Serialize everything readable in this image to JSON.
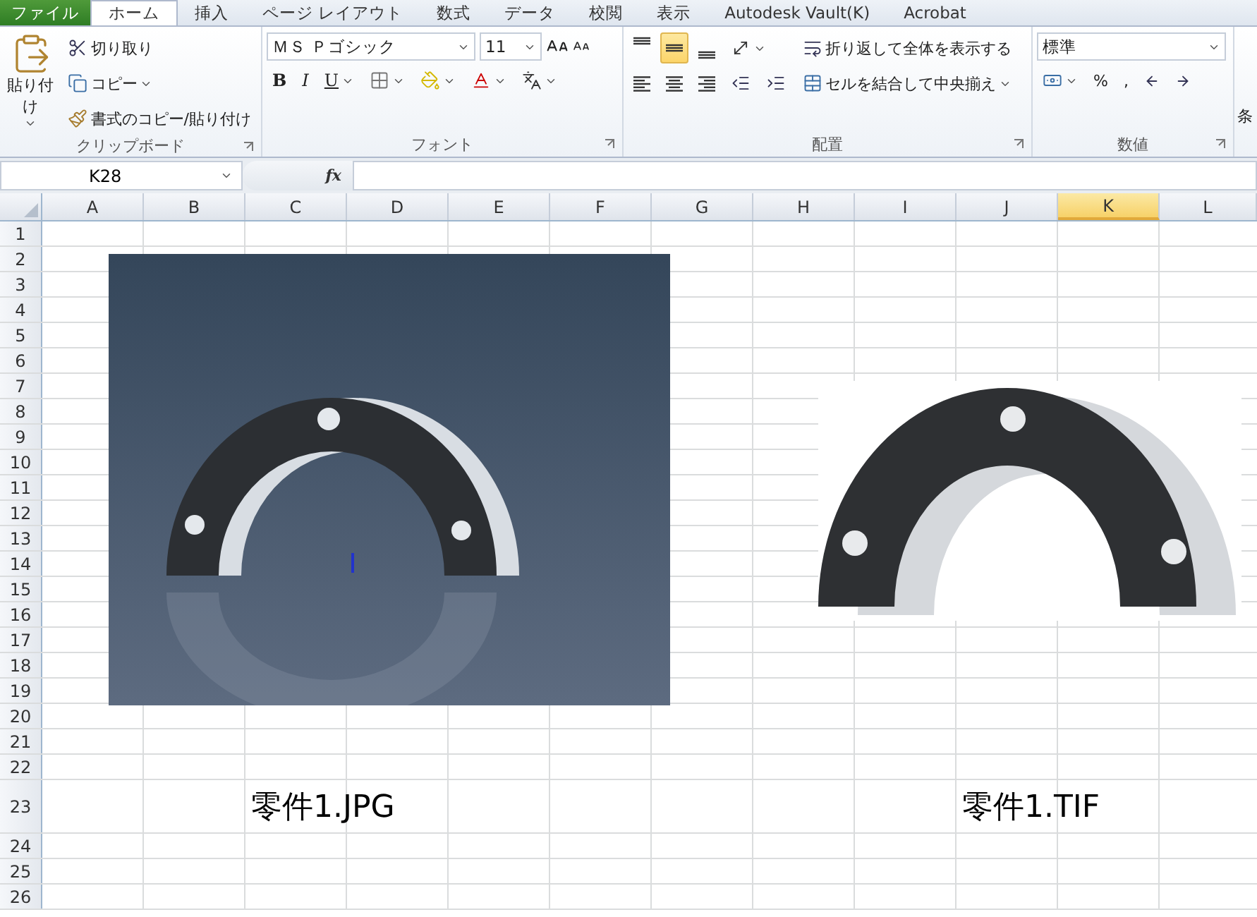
{
  "tabs": [
    {
      "label": "ファイル",
      "kind": "file",
      "selected": false
    },
    {
      "label": "ホーム",
      "kind": "tab",
      "selected": true
    },
    {
      "label": "挿入",
      "kind": "tab",
      "selected": false
    },
    {
      "label": "ページ レイアウト",
      "kind": "tab",
      "selected": false
    },
    {
      "label": "数式",
      "kind": "tab",
      "selected": false
    },
    {
      "label": "データ",
      "kind": "tab",
      "selected": false
    },
    {
      "label": "校閲",
      "kind": "tab",
      "selected": false
    },
    {
      "label": "表示",
      "kind": "tab",
      "selected": false
    },
    {
      "label": "Autodesk Vault(K)",
      "kind": "tab",
      "selected": false
    },
    {
      "label": "Acrobat",
      "kind": "tab",
      "selected": false
    }
  ],
  "clipboard": {
    "paste": "貼り付け",
    "cut": "切り取り",
    "copy": "コピー",
    "format_painter": "書式のコピー/貼り付け",
    "label": "クリップボード"
  },
  "font": {
    "name": "ＭＳ Ｐゴシック",
    "size": "11",
    "bold": "B",
    "italic": "I",
    "underline": "U",
    "label": "フォント"
  },
  "alignment": {
    "vertical": [
      {
        "selected": false
      },
      {
        "selected": true
      },
      {
        "selected": false
      }
    ],
    "wrap": "折り返して全体を表示する",
    "merge": "セルを結合して中央揃え",
    "label": "配置"
  },
  "number": {
    "format": "標準",
    "percent": "%",
    "comma": ",",
    "label": "数値"
  },
  "next_group": {
    "label_cut": "条"
  },
  "formula_bar": {
    "name_box": "K28",
    "fx": "fx"
  },
  "columns": [
    {
      "label": "A",
      "selected": false
    },
    {
      "label": "B",
      "selected": false
    },
    {
      "label": "C",
      "selected": false
    },
    {
      "label": "D",
      "selected": false
    },
    {
      "label": "E",
      "selected": false
    },
    {
      "label": "F",
      "selected": false
    },
    {
      "label": "G",
      "selected": false
    },
    {
      "label": "H",
      "selected": false
    },
    {
      "label": "I",
      "selected": false
    },
    {
      "label": "J",
      "selected": false
    },
    {
      "label": "K",
      "selected": true
    },
    {
      "label": "L",
      "selected": false
    }
  ],
  "rows": [
    {
      "label": "1"
    },
    {
      "label": "2"
    },
    {
      "label": "3"
    },
    {
      "label": "4"
    },
    {
      "label": "5"
    },
    {
      "label": "6"
    },
    {
      "label": "7"
    },
    {
      "label": "8"
    },
    {
      "label": "9"
    },
    {
      "label": "10"
    },
    {
      "label": "11"
    },
    {
      "label": "12"
    },
    {
      "label": "13"
    },
    {
      "label": "14"
    },
    {
      "label": "15"
    },
    {
      "label": "16"
    },
    {
      "label": "17"
    },
    {
      "label": "18"
    },
    {
      "label": "19"
    },
    {
      "label": "20"
    },
    {
      "label": "21"
    },
    {
      "label": "22"
    },
    {
      "label": "23",
      "cells": {
        "C": "零件1.JPG",
        "J": "零件1.TIF"
      }
    },
    {
      "label": "24"
    },
    {
      "label": "25"
    },
    {
      "label": "26"
    }
  ]
}
